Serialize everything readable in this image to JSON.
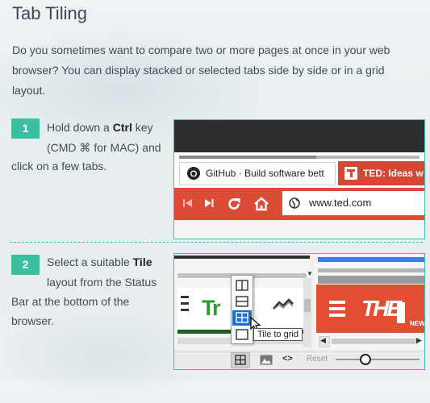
{
  "title": "Tab Tiling",
  "intro": "Do you sometimes want to compare two or more pages at once in your web browser? You can display stacked or selected tabs side by side or in a grid layout.",
  "steps": [
    {
      "number": "1",
      "line1_pre": "Hold down a ",
      "line1_bold": "Ctrl",
      "line1_post": " key",
      "line2": "(CMD ⌘ for MAC) and",
      "line3": "click on a few tabs."
    },
    {
      "number": "2",
      "line1_pre": "Select a suitable ",
      "line1_bold": "Tile",
      "line2": "layout from the Status",
      "line3": "Bar at the bottom of the",
      "line4": "browser."
    }
  ],
  "screenshot1": {
    "tab1_title": "GitHub · Build software bett",
    "tab2_title": "TED: Ideas w",
    "address": "www.ted.com",
    "colors": {
      "ted_red": "#dc4b36",
      "tab_dark": "#2e2e2e"
    }
  },
  "screenshot2": {
    "tooltip": "Tile to grid",
    "reset_label": "Reset",
    "the_text": "THE",
    "new_text": "NEW",
    "menu_options": [
      "tile-vertical",
      "tile-horizontal",
      "tile-grid",
      "untile"
    ],
    "selected_option": "tile-grid",
    "colors": {
      "accent": "#3cbfa0",
      "highlight": "#1f6fd1"
    }
  }
}
